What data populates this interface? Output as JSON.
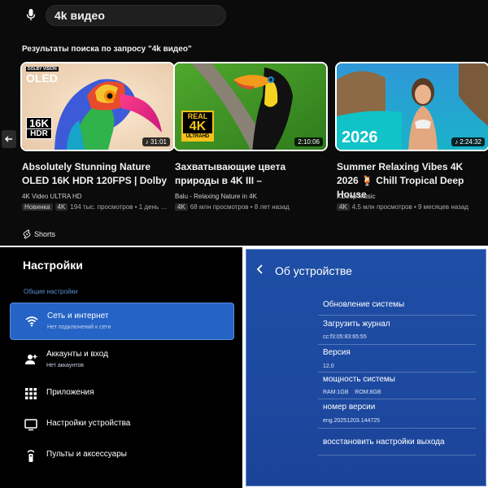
{
  "youtube": {
    "search_query": "4k видео",
    "results_title": "Результаты поиска по запросу \"4k видео\"",
    "videos": [
      {
        "title": "Absolutely Stunning Nature OLED 16K HDR 120FPS | Dolby",
        "channel": "4K Video ULTRA HD",
        "badges": [
          "Новинка",
          "4K"
        ],
        "meta": "194 тыс. просмотров • 1 день …",
        "duration": "31:01",
        "thumb_text_1": "16K",
        "thumb_text_2": "HDR",
        "thumb_text_3": "OLED",
        "thumb_text_4": "DOLBY VISION"
      },
      {
        "title": "Захватывающие цвета природы в 4K III –",
        "channel": "Balu - Relaxing Nature in 4K",
        "badges": [
          "4K"
        ],
        "meta": "68 млн просмотров • 8 лет назад",
        "duration": "2:10:06",
        "thumb_text_1": "REAL",
        "thumb_text_2": "4K",
        "thumb_text_3": "ULTRAHD"
      },
      {
        "title": "Summer Relaxing Vibes 4K 2026 🍹 Chill Tropical Deep House",
        "channel": "XDeep Music",
        "badges": [
          "4K"
        ],
        "meta": "4,5 млн просмотров • 9 месяцев назад",
        "duration": "2:24:32",
        "thumb_text_1": "2026"
      }
    ],
    "shorts_label": "Shorts"
  },
  "settings": {
    "title": "Настройки",
    "section": "Общие настройки",
    "items": [
      {
        "label": "Сеть и интернет",
        "sub": "Нет подключений к сети",
        "icon": "wifi-icon"
      },
      {
        "label": "Аккаунты и вход",
        "sub": "Нет аккаунтов",
        "icon": "account-icon"
      },
      {
        "label": "Приложения",
        "sub": "",
        "icon": "apps-grid-icon"
      },
      {
        "label": "Настройки устройства",
        "sub": "",
        "icon": "tv-icon"
      },
      {
        "label": "Пульты и аксессуары",
        "sub": "",
        "icon": "remote-icon"
      }
    ]
  },
  "about": {
    "title": "Об устройстве",
    "rows": [
      {
        "label": "Обновление системы",
        "value": ""
      },
      {
        "label": "Загрузить журнал",
        "value": "cc:f3:05:83:65:55"
      },
      {
        "label": "Версия",
        "value": "12.0"
      },
      {
        "label": "мощность системы",
        "value": "RAM:1GB    ROM:8GB"
      },
      {
        "label": "номер версии",
        "value": "eng.20251203.144725"
      },
      {
        "label": "восстановить настройки выхода",
        "value": ""
      }
    ]
  },
  "colors": {
    "accent_blue": "#2563c6",
    "about_bg": "#1e4ea6",
    "yt_bg": "#0b0b0b"
  }
}
